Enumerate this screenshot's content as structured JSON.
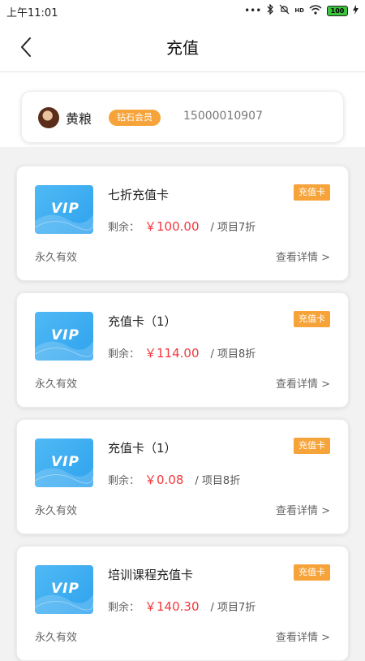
{
  "statusbar": {
    "time": "上午11:01",
    "signal_dots": "•••",
    "hd_label": "HD",
    "battery_label": "100"
  },
  "header": {
    "title": "充值"
  },
  "member": {
    "name": "黄粮",
    "badge": "钻石会员",
    "phone": "15000010907"
  },
  "cards": [
    {
      "vip_label": "VIP",
      "title": "七折充值卡",
      "tag": "充值卡",
      "balance_label": "剩余：",
      "balance": "￥100.00",
      "note": "/ 项目7折",
      "validity": "永久有效",
      "detail_link": "查看详情 >"
    },
    {
      "vip_label": "VIP",
      "title": "充值卡（1）",
      "tag": "充值卡",
      "balance_label": "剩余：",
      "balance": "￥114.00",
      "note": "/ 项目8折",
      "validity": "永久有效",
      "detail_link": "查看详情 >"
    },
    {
      "vip_label": "VIP",
      "title": "充值卡（1）",
      "tag": "充值卡",
      "balance_label": "剩余：",
      "balance": "￥0.08",
      "note": "/ 项目8折",
      "validity": "永久有效",
      "detail_link": "查看详情 >"
    },
    {
      "vip_label": "VIP",
      "title": "培训课程充值卡",
      "tag": "充值卡",
      "balance_label": "剩余：",
      "balance": "￥140.30",
      "note": "/ 项目7折",
      "validity": "永久有效",
      "detail_link": "查看详情 >"
    }
  ],
  "colors": {
    "accent_orange": "#f6a33a",
    "price_red": "#f2383d",
    "vip_blue": "#3aabf1"
  }
}
